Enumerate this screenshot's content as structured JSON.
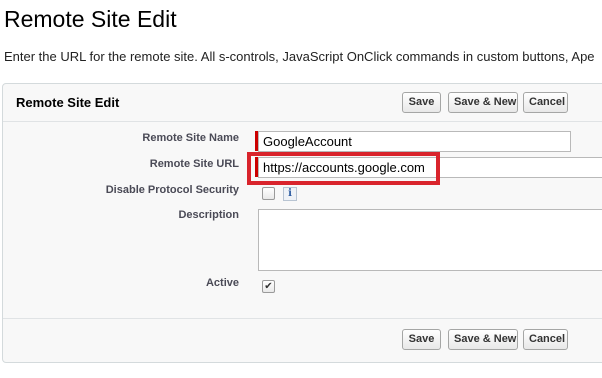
{
  "page": {
    "title": "Remote Site Edit",
    "description": "Enter the URL for the remote site. All s-controls, JavaScript OnClick commands in custom buttons, Ape"
  },
  "panel": {
    "title": "Remote Site Edit",
    "buttons": {
      "save": "Save",
      "save_new": "Save & New",
      "cancel": "Cancel"
    }
  },
  "form": {
    "remote_site_name": {
      "label": "Remote Site Name",
      "value": "GoogleAccount",
      "required": true
    },
    "remote_site_url": {
      "label": "Remote Site URL",
      "value": "https://accounts.google.com",
      "required": true
    },
    "disable_protocol_security": {
      "label": "Disable Protocol Security",
      "checked": false,
      "info_icon": "i"
    },
    "description": {
      "label": "Description",
      "value": ""
    },
    "active": {
      "label": "Active",
      "checked": true,
      "check_glyph": "✔"
    }
  },
  "footer": {
    "buttons": {
      "save": "Save",
      "save_new": "Save & New",
      "cancel": "Cancel"
    }
  },
  "colors": {
    "required_marker": "#cc0000",
    "highlight": "#d9242c",
    "panel_background": "#f8f8f8"
  },
  "icons": {
    "info": "info-icon",
    "checkmark": "checkmark-icon"
  }
}
